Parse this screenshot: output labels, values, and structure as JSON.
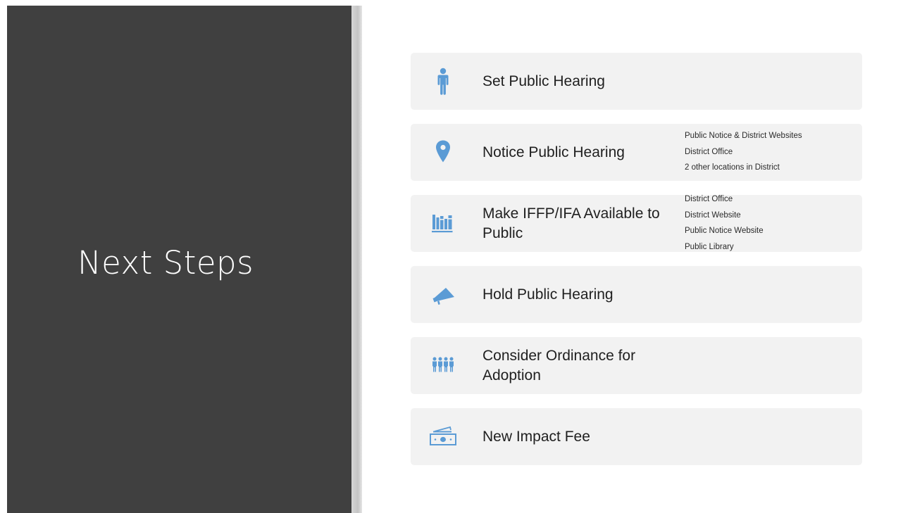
{
  "slide": {
    "title": "Next Steps",
    "accent_color": "#5b9bd5",
    "panel_color": "#404040",
    "card_color": "#f2f2f2"
  },
  "steps": [
    {
      "icon": "person-icon",
      "label": "Set Public Hearing",
      "notes": []
    },
    {
      "icon": "map-pin-icon",
      "label": "Notice Public Hearing",
      "notes": [
        "Public Notice & District Websites",
        "District Office",
        "2 other locations in District"
      ]
    },
    {
      "icon": "library-books-icon",
      "label": "Make IFFP/IFA Available to Public",
      "notes": [
        "District Office",
        "District Website",
        "Public Notice Website",
        "Public Library"
      ]
    },
    {
      "icon": "megaphone-icon",
      "label": "Hold Public Hearing",
      "notes": []
    },
    {
      "icon": "group-people-icon",
      "label": "Consider Ordinance for Adoption",
      "notes": []
    },
    {
      "icon": "money-icon",
      "label": "New Impact Fee",
      "notes": []
    }
  ]
}
